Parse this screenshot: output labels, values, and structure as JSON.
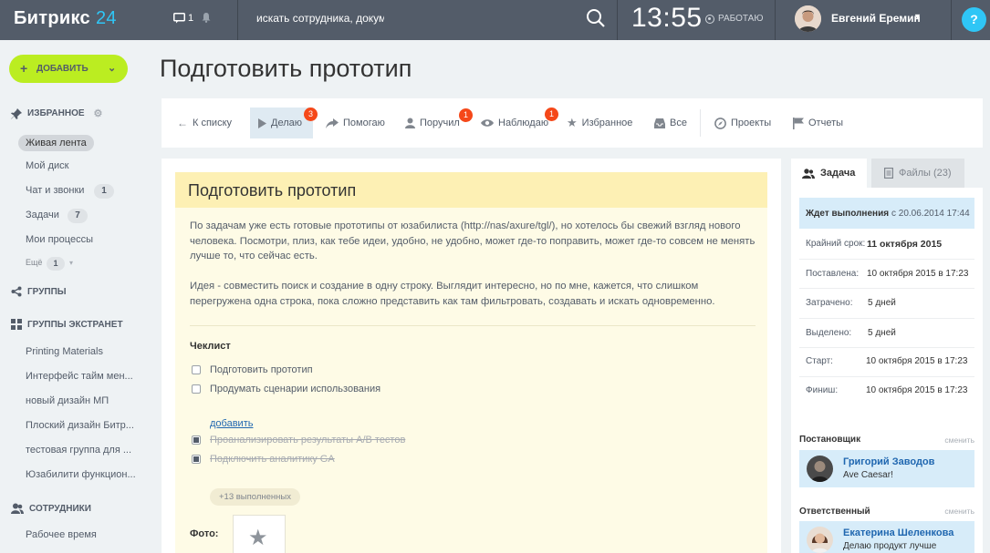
{
  "topbar": {
    "logo": "Битрикс",
    "logo_num": "24",
    "messages_count": "1",
    "search_text": "искать сотрудника, документ",
    "time": "13:55",
    "work_status": "РАБОТАЮ",
    "user_name": "Евгений Еремин",
    "help": "?"
  },
  "sidebar": {
    "add_button": "ДОБАВИТЬ",
    "favorites_title": "ИЗБРАННОЕ",
    "favorites": [
      {
        "label": "Живая лента"
      },
      {
        "label": "Мой диск"
      },
      {
        "label": "Чат и звонки",
        "count": "1"
      },
      {
        "label": "Задачи",
        "count": "7"
      },
      {
        "label": "Мои процессы"
      }
    ],
    "more_label": "Ещё",
    "more_count": "1",
    "groups_title": "ГРУППЫ",
    "extranet_title": "ГРУППЫ ЭКСТРАНЕТ",
    "extranet": [
      {
        "label": "Printing Materials"
      },
      {
        "label": "Интерфейс тайм мен..."
      },
      {
        "label": "новый дизайн МП"
      },
      {
        "label": "Плоский дизайн Битр..."
      },
      {
        "label": "тестовая группа для ..."
      },
      {
        "label": "Юзабилити функцион..."
      }
    ],
    "employees_title": "СОТРУДНИКИ",
    "employees": [
      {
        "label": "Рабочее время"
      }
    ]
  },
  "page_title": "Подготовить прототип",
  "tabs": {
    "back": "К списку",
    "doing": "Делаю",
    "doing_badge": "3",
    "helping": "Помогаю",
    "assigned": "Поручил",
    "assigned_badge": "1",
    "watching": "Наблюдаю",
    "watching_badge": "1",
    "favorite": "Избранное",
    "all": "Все",
    "projects": "Проекты",
    "reports": "Отчеты"
  },
  "task": {
    "title": "Подготовить прототип",
    "desc1": "По задачам уже есть готовые прототипы от юзабилиста (http://nas/axure/tgl/), но хотелось бы свежий взгляд нового человека. Посмотри, плиз, как тебе идеи, удобно, не удобно, может где-то поправить, может где-то совсем не менять лучше то, что сейчас есть.",
    "desc2": "Идея - совместить поиск и создание в одну строку. Выглядит интересно, но по мне, кажется, что слишком перегружена одна строка, пока сложно представить как там фильтровать, создавать и искать одновременно.",
    "checklist_title": "Чеклист",
    "checklist": [
      {
        "label": "Подготовить прототип",
        "done": false
      },
      {
        "label": "Продумать сценарии использования",
        "done": false
      }
    ],
    "add_link": "добавить",
    "checklist_done": [
      {
        "label": "Проанализировать результаты A/B тестов",
        "done": true
      },
      {
        "label": "Подключить аналитику GA",
        "done": true
      }
    ],
    "more_done": "+13 выполненных",
    "photo_label": "Фото:"
  },
  "panel": {
    "tab_task": "Задача",
    "tab_files": "Файлы (23)",
    "status": "Ждет выполнения",
    "status_since": "с 20.06.2014 17:44",
    "rows": [
      {
        "label": "Крайний срок:",
        "value": "11 октября 2015"
      },
      {
        "label": "Поставлена:",
        "value": "10 октября 2015 в 17:23"
      },
      {
        "label": "Затрачено:",
        "value": "5 дней"
      },
      {
        "label": "Выделено:",
        "value": "5 дней"
      },
      {
        "label": "Старт:",
        "value": "10 октября 2015 в 17:23"
      },
      {
        "label": "Финиш:",
        "value": "10 октября 2015 в 17:23"
      }
    ],
    "creator_title": "Постановщик",
    "creator_change": "сменить",
    "creator_name": "Григорий Заводов",
    "creator_status": "Ave Caesar!",
    "responsible_title": "Ответственный",
    "responsible_change": "сменить",
    "responsible_name": "Екатерина Шеленкова",
    "responsible_status": "Делаю продукт лучше"
  },
  "colors": {
    "topbar": "#535c69",
    "accent": "#2fc6f6",
    "add_button": "#bbed21",
    "badge": "#f54819",
    "task_header": "#fdf0b4",
    "panel_highlight": "#d7ecf9"
  }
}
